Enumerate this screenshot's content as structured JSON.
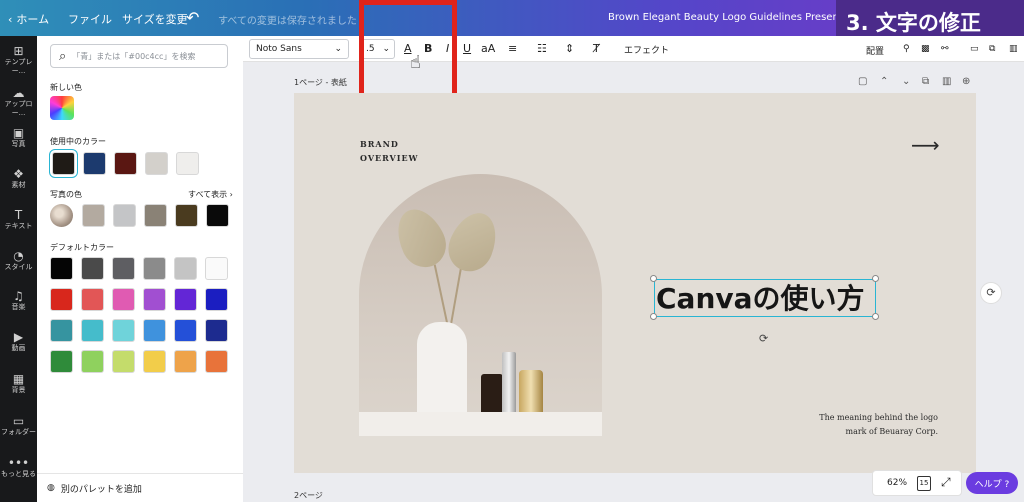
{
  "topbar": {
    "home": "ホーム",
    "file": "ファイル",
    "resize": "サイズを変更",
    "saved_status": "すべての変更は保存されました",
    "title": "Brown Elegant Beauty Logo Guidelines Presentation"
  },
  "step_badge": "3. 文字の修正",
  "rail": [
    {
      "icon": "template-icon",
      "glyph": "⊞",
      "label": "テンプレー..."
    },
    {
      "icon": "upload-icon",
      "glyph": "☁",
      "label": "アップロー..."
    },
    {
      "icon": "photo-icon",
      "glyph": "▣",
      "label": "写真"
    },
    {
      "icon": "elements-icon",
      "glyph": "❖",
      "label": "素材"
    },
    {
      "icon": "text-icon",
      "glyph": "T",
      "label": "テキスト"
    },
    {
      "icon": "style-icon",
      "glyph": "◔",
      "label": "スタイル"
    },
    {
      "icon": "music-icon",
      "glyph": "♫",
      "label": "音楽"
    },
    {
      "icon": "video-icon",
      "glyph": "▶",
      "label": "動画"
    },
    {
      "icon": "background-icon",
      "glyph": "▦",
      "label": "背景"
    },
    {
      "icon": "folder-icon",
      "glyph": "▭",
      "label": "フォルダー"
    },
    {
      "icon": "more-icon",
      "glyph": "•••",
      "label": "もっと見る"
    }
  ],
  "panel": {
    "search_placeholder": "「青」または「#00c4cc」を検索",
    "new_color_label": "新しい色",
    "in_use_label": "使用中のカラー",
    "in_use_colors": [
      "#1f1b16",
      "#1c3a6e",
      "#5a1712",
      "#d3d0cb",
      "#efeeec"
    ],
    "photo_colors_label": "写真の色",
    "see_all": "すべて表示",
    "photo_colors": [
      "#b3aaa0",
      "#c4c5c7",
      "#8a8276",
      "#4a3b1f",
      "#0a0a0a"
    ],
    "default_label": "デフォルトカラー",
    "default_colors": [
      [
        "#050505",
        "#4a4a4a",
        "#5e5e62",
        "#8b8b8b",
        "#c4c4c4",
        "#fafafa"
      ],
      [
        "#d8271c",
        "#e25656",
        "#e05bb2",
        "#a14fd1",
        "#6326d6",
        "#1b1ec1"
      ],
      [
        "#3694a0",
        "#45bccb",
        "#6fd3da",
        "#3f92dd",
        "#2450d8",
        "#1d2b8f"
      ],
      [
        "#2f8b3a",
        "#8fd15e",
        "#c4dc6b",
        "#f2cd4a",
        "#eea34a",
        "#e8733a"
      ]
    ],
    "add_palette": "別のパレットを追加"
  },
  "toolbar": {
    "font": "Noto Sans",
    "size": ".5",
    "text_color_glyph": "A",
    "bold": "B",
    "italic": "I",
    "underline": "U",
    "case": "aA",
    "effects": "エフェクト",
    "position": "配置"
  },
  "canvas": {
    "page1_label": "1ページ - 表紙",
    "page2_label": "2ページ",
    "brand_line1": "BRAND",
    "brand_line2": "OVERVIEW",
    "arrow": "⟶",
    "headline": "Canvaの使い方",
    "tagline_line1": "The meaning behind the logo",
    "tagline_line2": "mark of Beuaray Corp."
  },
  "footer": {
    "zoom": "62%",
    "page_count": "15",
    "help": "ヘルプ ?"
  }
}
